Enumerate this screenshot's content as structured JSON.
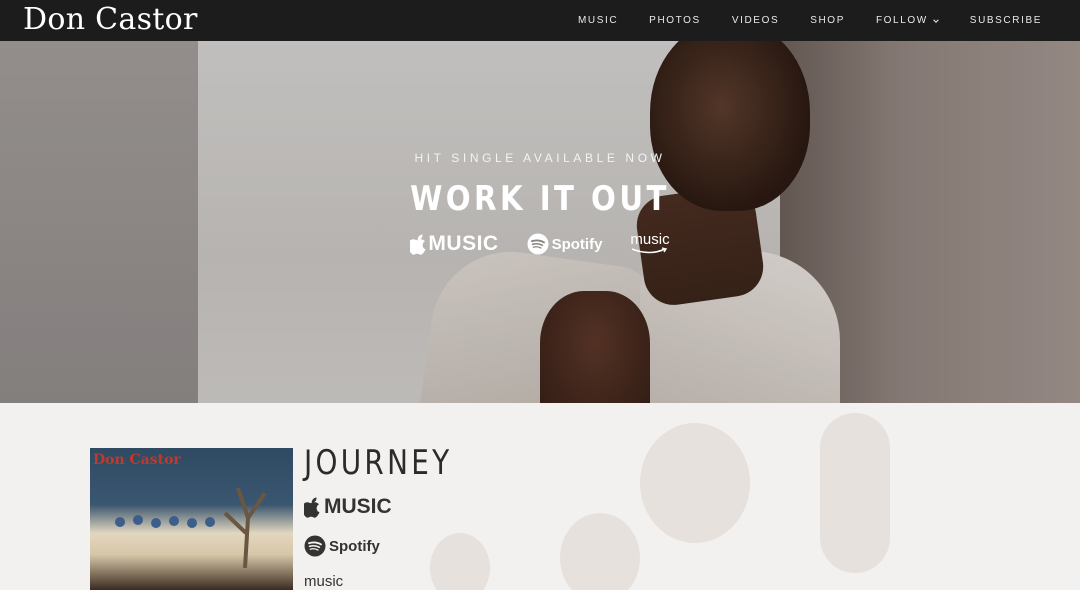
{
  "header": {
    "brand": "Don Castor",
    "nav": [
      {
        "label": "MUSIC"
      },
      {
        "label": "PHOTOS"
      },
      {
        "label": "VIDEOS"
      },
      {
        "label": "SHOP"
      },
      {
        "label": "FOLLOW",
        "has_dropdown": true
      },
      {
        "label": "SUBSCRIBE"
      }
    ]
  },
  "hero": {
    "eyebrow": "HIT SINGLE AVAILABLE NOW",
    "title": "WORK IT OUT",
    "services": {
      "apple": "MUSIC",
      "spotify": "Spotify",
      "amazon": "music"
    }
  },
  "release": {
    "cover_artist": "Don Castor",
    "title": "JOURNEY",
    "links": {
      "apple": "MUSIC",
      "spotify": "Spotify",
      "amazon": "music"
    }
  },
  "colors": {
    "nav_bg": "#1d1c1c",
    "section_bg": "#f3f1ef",
    "cover_title": "#c0392b"
  }
}
